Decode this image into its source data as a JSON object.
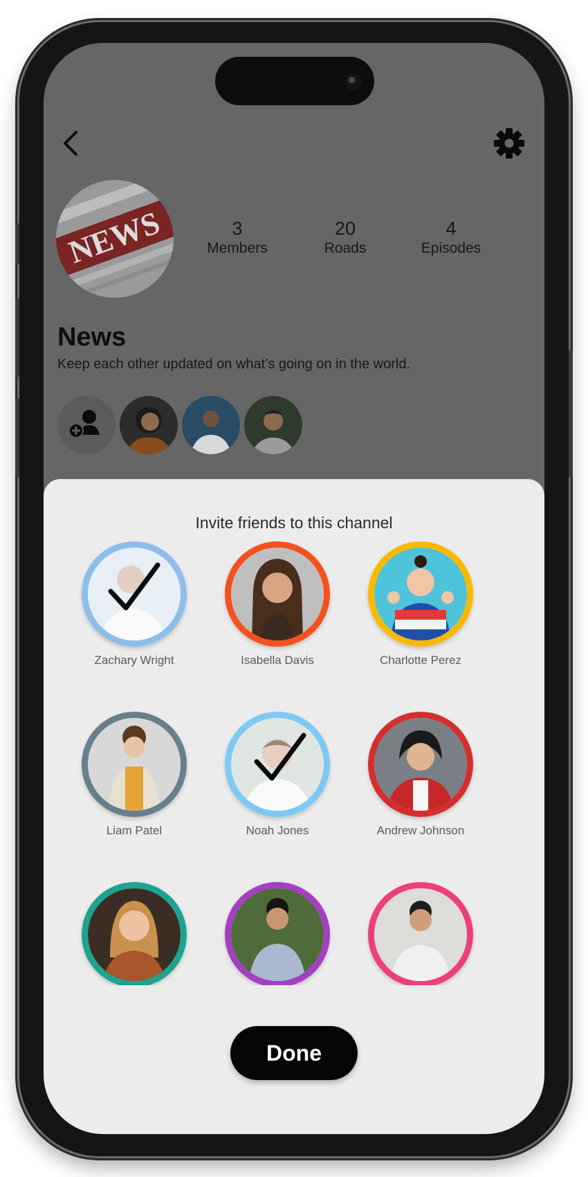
{
  "channel": {
    "name": "News",
    "description": "Keep each other updated on what’s going on in the world.",
    "cover_text": "NEWS",
    "stats": [
      {
        "value": "3",
        "label": "Members"
      },
      {
        "value": "20",
        "label": "Roads"
      },
      {
        "value": "4",
        "label": "Episodes"
      }
    ]
  },
  "icons": {
    "back": "chevron-left-icon",
    "settings": "gear-icon",
    "add_member": "add-person-icon",
    "selected": "checkmark-icon"
  },
  "invite_sheet": {
    "title": "Invite friends to this channel",
    "done_label": "Done",
    "friends": [
      {
        "name": "Zachary Wright",
        "ring_color": "#8fbdea",
        "selected": true
      },
      {
        "name": "Isabella Davis",
        "ring_color": "#f4511e",
        "selected": false
      },
      {
        "name": "Charlotte Perez",
        "ring_color": "#f9b900",
        "selected": false
      },
      {
        "name": "Liam Patel",
        "ring_color": "#667f8c",
        "selected": false
      },
      {
        "name": "Noah Jones",
        "ring_color": "#7cc9f4",
        "selected": true
      },
      {
        "name": "Andrew Johnson",
        "ring_color": "#d32f2f",
        "selected": false
      },
      {
        "name": "",
        "ring_color": "#1fa391",
        "selected": false
      },
      {
        "name": "",
        "ring_color": "#a43fc2",
        "selected": false
      },
      {
        "name": "",
        "ring_color": "#ec407a",
        "selected": false
      }
    ]
  }
}
